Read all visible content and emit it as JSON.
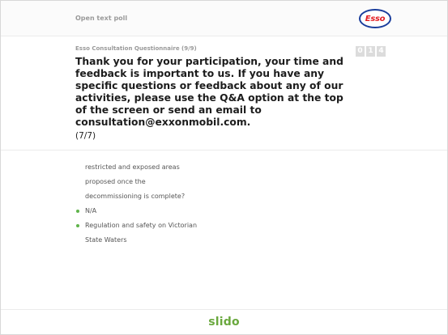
{
  "header": {
    "poll_type": "Open text poll",
    "brand_logo": "Esso"
  },
  "question": {
    "meta": "Esso Consultation Questionnaire (9/9)",
    "text": "Thank you for your participation, your time and feedback is important to us. If you have any specific questions or feedback about any of our activities, please use the Q&A option at the top of the screen or send an email to consultation@exxonmobil.com.",
    "count": "(7/7)",
    "response_counter": [
      "0",
      "1",
      "4"
    ]
  },
  "answers": [
    {
      "text": "restricted and exposed areas",
      "bullet": false
    },
    {
      "text": "proposed once the",
      "bullet": false
    },
    {
      "text": "decommissioning is complete?",
      "bullet": false
    },
    {
      "text": "N/A",
      "bullet": true
    },
    {
      "text": "Regulation and safety on Victorian",
      "bullet": true
    },
    {
      "text": "State Waters",
      "bullet": false
    }
  ],
  "footer": {
    "brand": "slido"
  },
  "colors": {
    "bullet": "#5fb44b",
    "slido_green": "#6aa83e",
    "esso_red": "#e31e24",
    "esso_blue": "#1a3d9c"
  }
}
